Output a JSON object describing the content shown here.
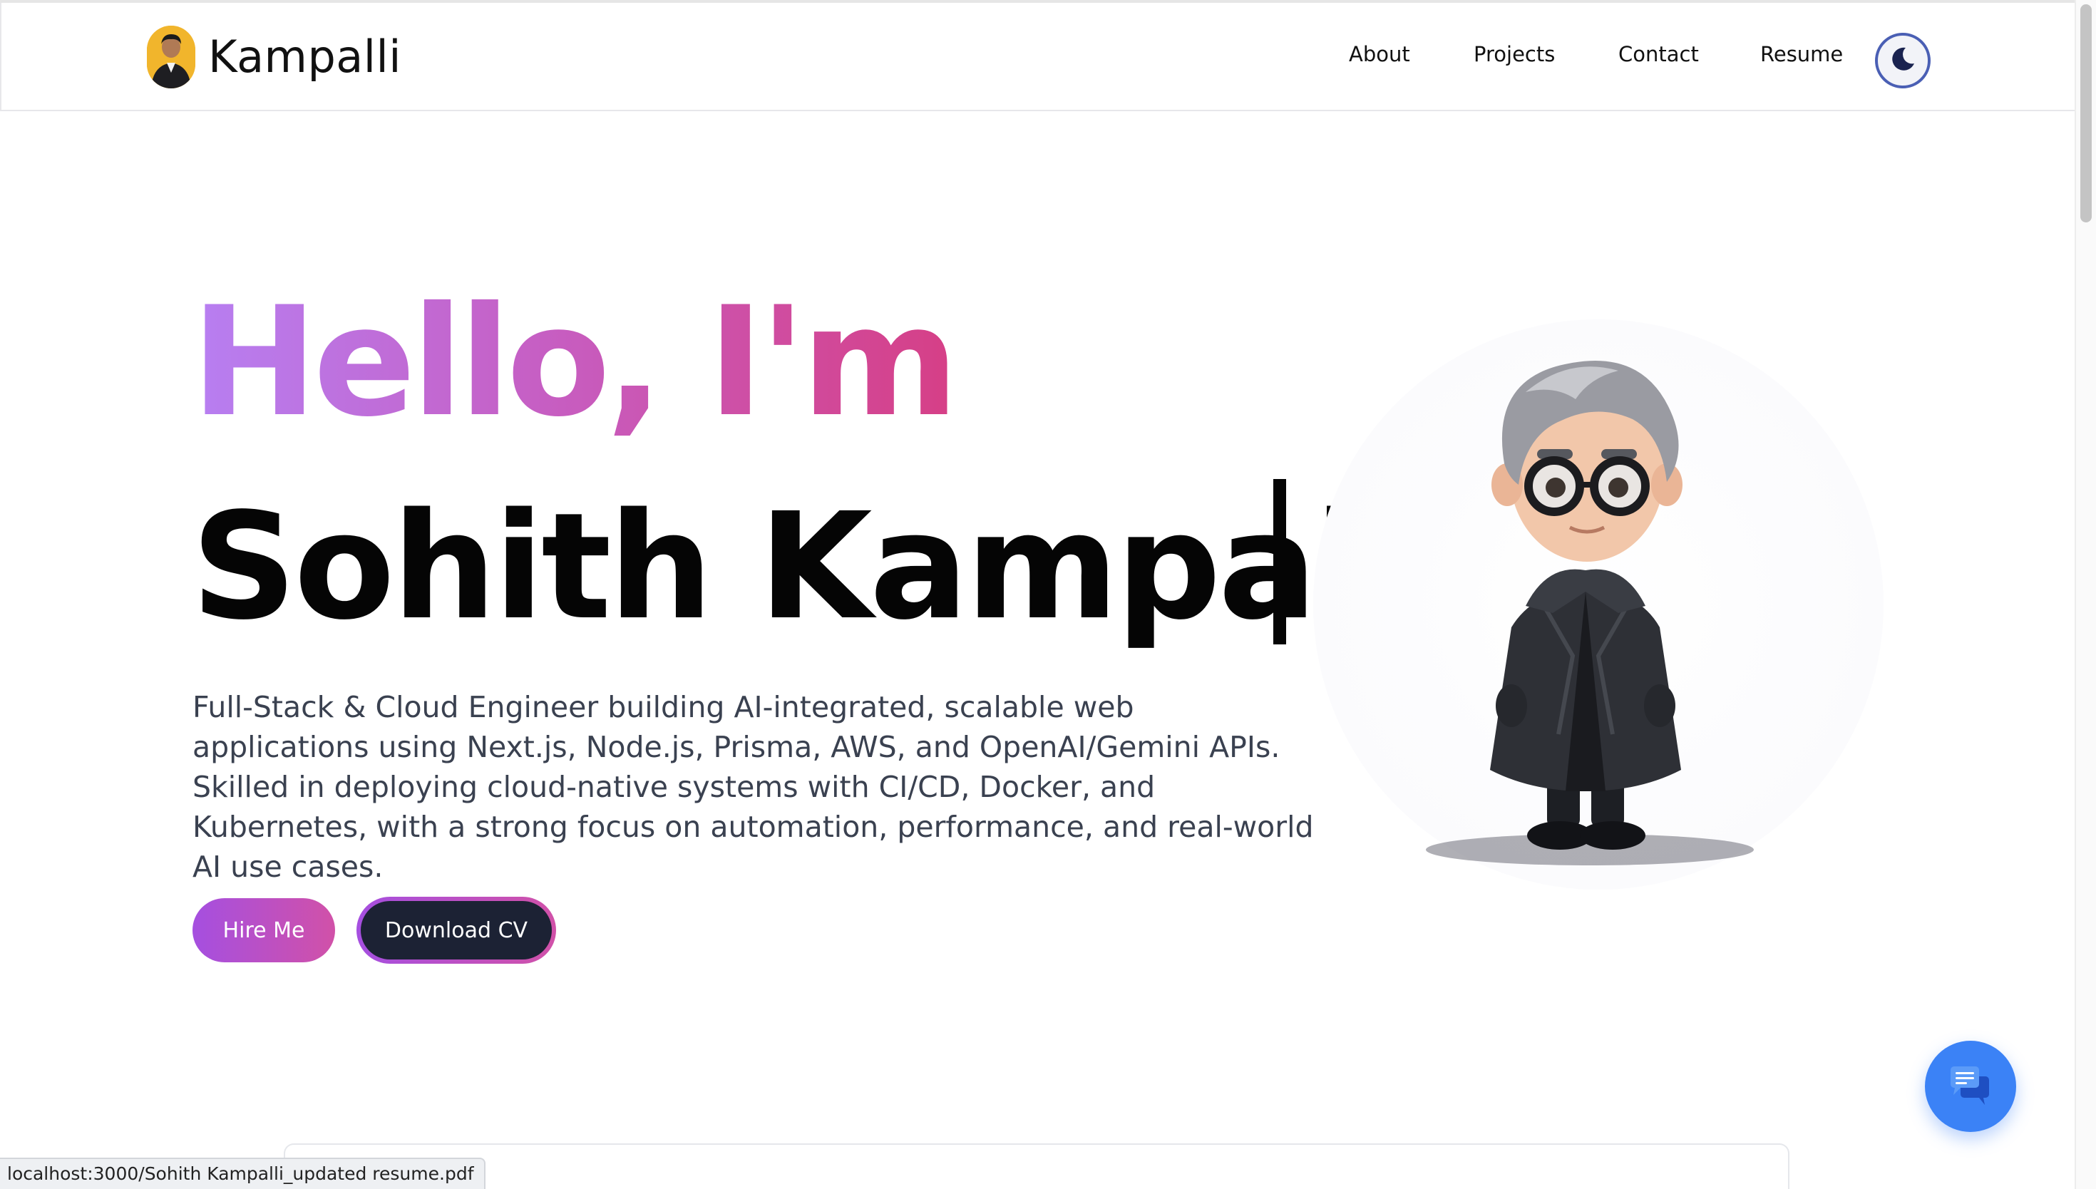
{
  "navbar": {
    "brand": "Kampalli",
    "links": [
      {
        "label": "About"
      },
      {
        "label": "Projects"
      },
      {
        "label": "Contact"
      },
      {
        "label": "Resume"
      }
    ],
    "theme_icon": "moon-icon"
  },
  "hero": {
    "greeting": "Hello, I'm",
    "name": "Sohith Kampalli",
    "description": "Full-Stack & Cloud Engineer building AI-integrated, scalable web applications using Next.js, Node.js, Prisma, AWS, and OpenAI/Gemini APIs. Skilled in deploying cloud-native systems with CI/CD, Docker, and Kubernetes, with a strong focus on automation, performance, and real-world AI use cases.",
    "hire_label": "Hire Me",
    "cv_label": "Download CV"
  },
  "chat": {
    "icon": "chat-icon"
  },
  "status_bar": {
    "url": "localhost:3000/Sohith Kampalli_updated resume.pdf"
  },
  "colors": {
    "gradient_start": "#b77ff2",
    "gradient_end": "#d63f86",
    "cv_button_bg": "#1c2234",
    "chat_fab": "#3b82f6",
    "toggle_border": "#4a5fb4"
  }
}
